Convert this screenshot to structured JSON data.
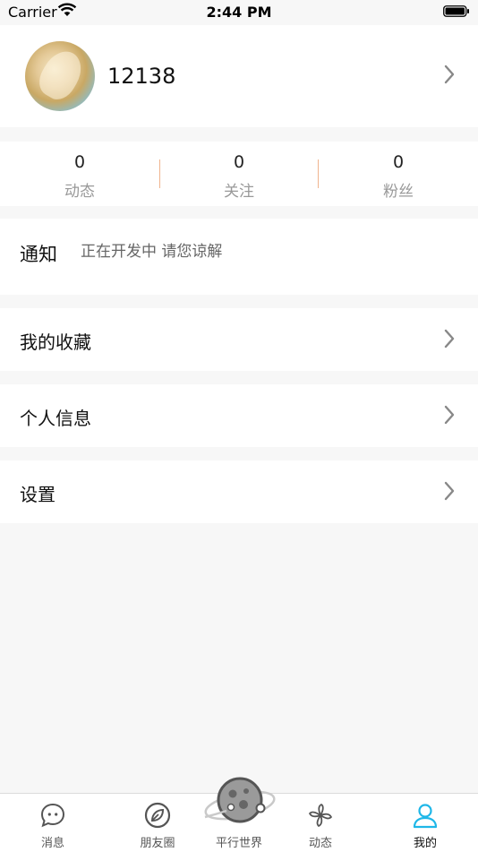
{
  "status_bar": {
    "carrier": "Carrier",
    "time": "2:44 PM"
  },
  "profile": {
    "username": "12138"
  },
  "stats": [
    {
      "count": "0",
      "label": "动态"
    },
    {
      "count": "0",
      "label": "关注"
    },
    {
      "count": "0",
      "label": "粉丝"
    }
  ],
  "notice": {
    "title": "通知",
    "text": "正在开发中 请您谅解"
  },
  "menu": [
    {
      "label": "我的收藏"
    },
    {
      "label": "个人信息"
    },
    {
      "label": "设置"
    }
  ],
  "tabbar": {
    "items": [
      {
        "label": "消息",
        "icon": "message-bubble-icon"
      },
      {
        "label": "朋友圈",
        "icon": "leaf-compass-icon"
      },
      {
        "label": "平行世界",
        "icon": "planet-icon"
      },
      {
        "label": "动态",
        "icon": "pinwheel-icon"
      },
      {
        "label": "我的",
        "icon": "person-icon"
      }
    ],
    "active_index": 4,
    "active_color": "#1fb7e8"
  }
}
